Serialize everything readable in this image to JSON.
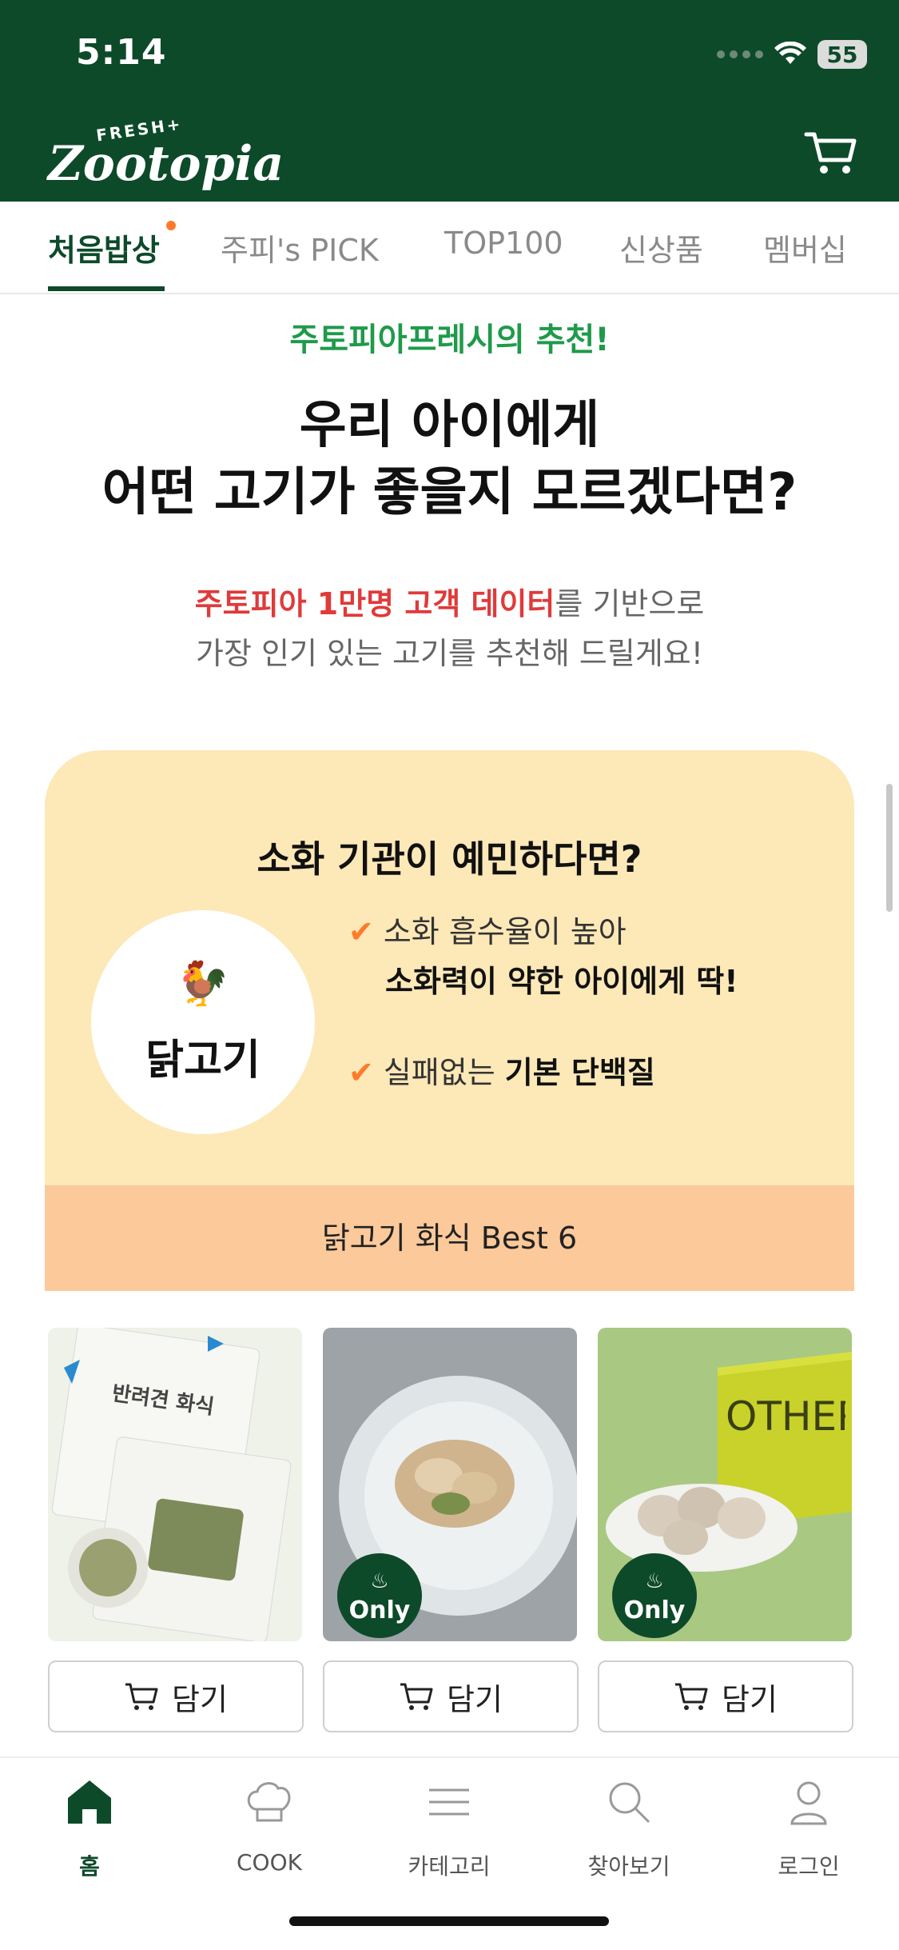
{
  "status_bar": {
    "time": "5:14",
    "battery": "55"
  },
  "header": {
    "logo_small": "FRESH+",
    "logo_main": "Zootopia",
    "cart_icon": "cart-icon"
  },
  "tabs": [
    {
      "label": "처음밥상",
      "active": true
    },
    {
      "label": "주피's PICK",
      "active": false
    },
    {
      "label": "TOP100",
      "active": false
    },
    {
      "label": "신상품",
      "active": false
    },
    {
      "label": "멤버십",
      "active": false
    }
  ],
  "hero": {
    "eyebrow": "주토피아프레시의 추천!",
    "headline_line1": "우리 아이에게",
    "headline_line2": "어떤 고기가 좋을지 모르겠다면?",
    "sub_highlight": "주토피아 1만명 고객 데이터",
    "sub_rest": "를 기반으로",
    "sub_line2": "가장 인기 있는 고기를 추천해 드릴게요!"
  },
  "card": {
    "title": "소화 기관이 예민하다면?",
    "meat_name": "닭고기",
    "meat_emoji": "🐓",
    "point1_line1": "소화 흡수율이 높아",
    "point1_line2": "소화력이 약한 아이에게 딱!",
    "point2_prefix": "실패없는",
    "point2_bold": "기본 단백질",
    "footer": "닭고기 화식 Best 6",
    "bg_color": "#fde8b8",
    "footer_color": "#fbc99a"
  },
  "products": [
    {
      "image_text": "반려견 화식",
      "badge": "",
      "add_label": "담기"
    },
    {
      "image_text": "",
      "badge": "Only",
      "add_label": "담기"
    },
    {
      "image_text": "OTHER MARS",
      "badge": "Only",
      "add_label": "담기"
    }
  ],
  "bottom_nav": [
    {
      "label": "홈",
      "icon": "home-icon",
      "active": true
    },
    {
      "label": "COOK",
      "icon": "chef-hat-icon",
      "active": false
    },
    {
      "label": "카테고리",
      "icon": "menu-icon",
      "active": false
    },
    {
      "label": "찾아보기",
      "icon": "search-icon",
      "active": false
    },
    {
      "label": "로그인",
      "icon": "user-icon",
      "active": false
    }
  ],
  "colors": {
    "brand_green": "#0d4a2a",
    "accent_green": "#1f9a4a",
    "highlight_red": "#e03a3a",
    "check_orange": "#ff7a2a"
  }
}
